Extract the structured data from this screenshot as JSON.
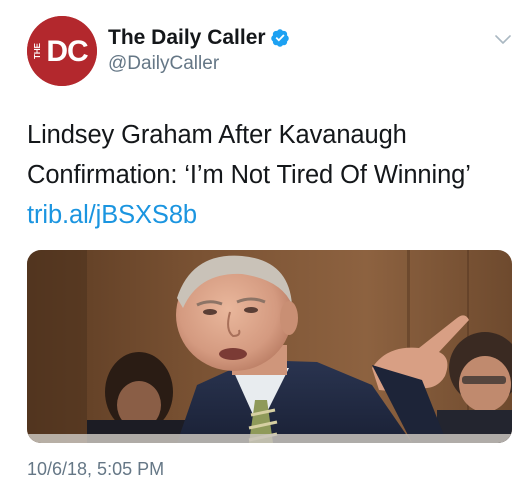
{
  "account": {
    "display_name": "The Daily Caller",
    "handle": "@DailyCaller",
    "verified": true,
    "avatar": {
      "logo_text": "DC",
      "logo_side_text": "THE",
      "color": "#b3282d"
    }
  },
  "tweet": {
    "text_lines": [
      "Lindsey Graham After Kavanaugh",
      "Confirmation: ‘I’m Not Tired Of Winning’"
    ],
    "link": "trib.al/jBSXS8b",
    "timestamp": "10/6/18, 5:05 PM"
  },
  "colors": {
    "link": "#1b95e0",
    "secondary_text": "#657786",
    "verified_badge": "#1da1f2"
  },
  "icons": {
    "verified": "verified-badge-icon",
    "menu": "chevron-down-icon"
  }
}
